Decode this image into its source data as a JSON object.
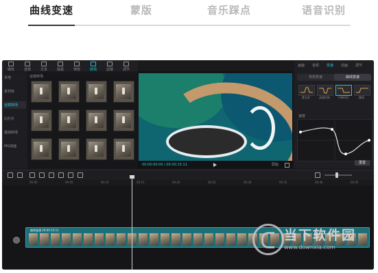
{
  "tabs": [
    {
      "label": "曲线变速",
      "active": true
    },
    {
      "label": "蒙版",
      "active": false
    },
    {
      "label": "音乐踩点",
      "active": false
    },
    {
      "label": "语音识别",
      "active": false
    }
  ],
  "editor": {
    "toolbar": [
      "媒体",
      "音频",
      "文本",
      "贴纸",
      "特效",
      "转场",
      "滤镜",
      "调节"
    ],
    "toolbar_active": "转场",
    "media_nav": [
      "本地",
      "素材库",
      "运镜转场",
      "幻灯片",
      "基础转场",
      "MG动画"
    ],
    "media_nav_active": "运镜转场",
    "media_header": "运镜转场",
    "preview": {
      "time": "00:00:00:00 / 00:00:15:11",
      "ratio": "原始"
    },
    "props": {
      "tabs": [
        "画面",
        "音频",
        "变速",
        "动画",
        "调节"
      ],
      "active_tab": "变速",
      "segments": [
        "常规变速",
        "曲线变速"
      ],
      "active_segment": "曲线变速",
      "presets": [
        "蒙太奇",
        "英雄时刻",
        "子弹时间",
        "跳接"
      ],
      "graph_label": "速度",
      "reset_label": "重置"
    },
    "ruler_ticks": [
      "00:00",
      "00:05",
      "00:10",
      "00:15",
      "00:20",
      "00:25",
      "00:30",
      "00:35",
      "00:40",
      "00:45"
    ],
    "clip_label": "曲线变速 00:00:15:11"
  },
  "watermark": {
    "text": "当下软件园",
    "url": "www.downxia.com"
  },
  "colors": {
    "accent": "#24c5d4",
    "clip": "#1d6f78"
  }
}
